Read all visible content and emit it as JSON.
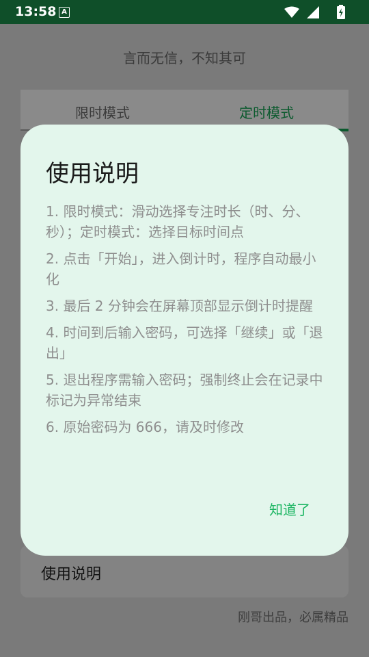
{
  "status_bar": {
    "time": "13:58",
    "badge": "A",
    "icons": [
      "wifi-icon",
      "signal-icon",
      "battery-charging-icon"
    ]
  },
  "background": {
    "motto": "言而无信，不知其可",
    "tabs": [
      {
        "label": "限时模式",
        "selected": false
      },
      {
        "label": "定时模式",
        "selected": true
      }
    ],
    "card_label": "使用说明",
    "footer": "刚哥出品，必属精品"
  },
  "dialog": {
    "title": "使用说明",
    "items": [
      "1. 限时模式：滑动选择专注时长（时、分、秒）；定时模式：选择目标时间点",
      "2. 点击「开始」，进入倒计时，程序自动最小化",
      "3. 最后 2 分钟会在屏幕顶部显示倒计时提醒",
      "4. 时间到后输入密码，可选择「继续」或「退出」",
      "5. 退出程序需输入密码；强制终止会在记录中标记为异常结束",
      "6. 原始密码为 666，请及时修改"
    ],
    "confirm_label": "知道了"
  },
  "colors": {
    "status_bar": "#0f4f29",
    "accent": "#1bb562",
    "dialog_bg": "#e3f6ec"
  }
}
